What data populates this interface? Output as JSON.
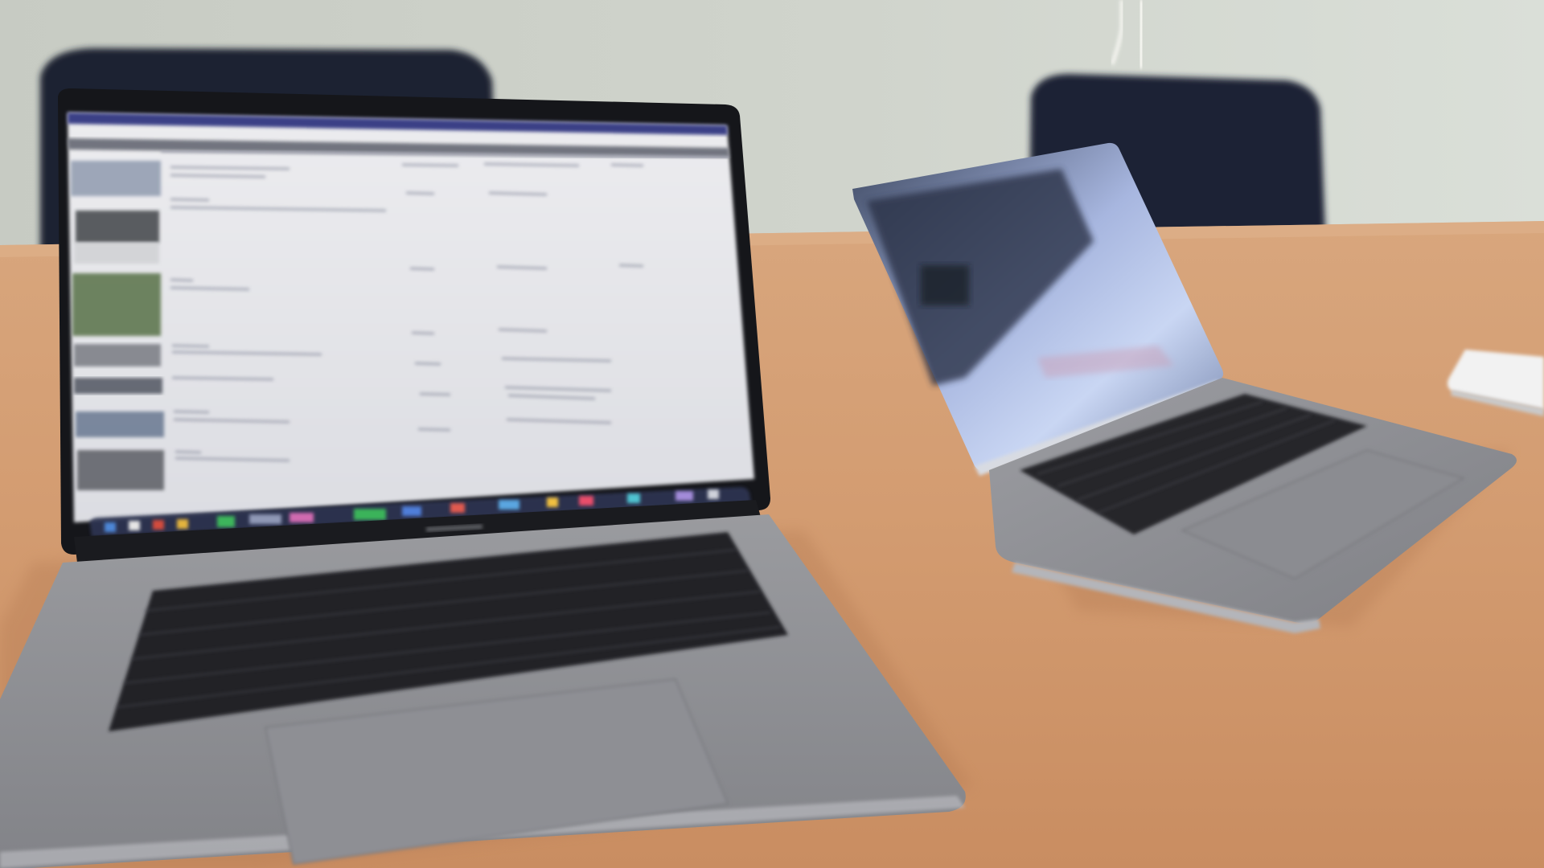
{
  "scene": {
    "palette": {
      "wall": "#cdd2ca",
      "wall_shadow": "#b9beb6",
      "table": "#d19a70",
      "table_light": "#dcae87",
      "table_shadow": "#b97f57",
      "chair": "#1d2433",
      "laptop_body": "#8d8e93",
      "laptop_body_light": "#a3a4a8",
      "laptop_bezel": "#17181c",
      "keyboard_keys": "#2a2b30",
      "screen_bg": "#e7e8ec",
      "screen_menubar": "#3a3f8a",
      "screen_toolbar": "#5b5f6b",
      "dock": "#2d3450",
      "reflection_blue": "#b7c9ee",
      "device_white": "#f1f1f1"
    },
    "objects": [
      "wall",
      "chair-left",
      "chair-right",
      "table",
      "laptop-large-open",
      "laptop-small-open",
      "white-device"
    ],
    "icons": [
      "laptop-icon",
      "chair-icon"
    ]
  }
}
